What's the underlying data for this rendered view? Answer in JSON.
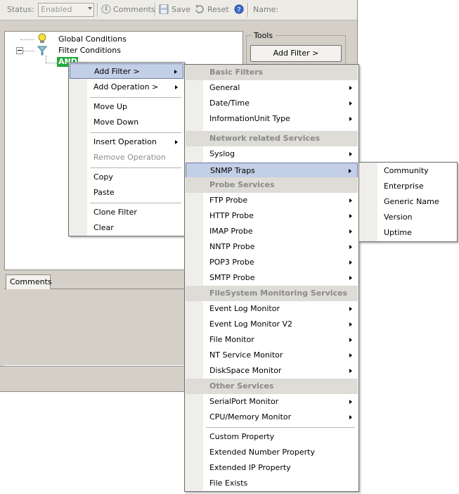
{
  "toolbar": {
    "status_label": "Status:",
    "status_value": "Enabled",
    "comments_label": "Comments",
    "save_label": "Save",
    "reset_label": "Reset",
    "name_label": "Name:"
  },
  "tree": {
    "global": "Global Conditions",
    "filter": "Filter Conditions",
    "and": "AND"
  },
  "tools": {
    "title": "Tools",
    "add_filter": "Add Filter >"
  },
  "comments_tab": "Comments",
  "context_menu": {
    "add_filter": "Add Filter >",
    "add_operation": "Add Operation >",
    "move_up": "Move Up",
    "move_down": "Move Down",
    "insert_operation": "Insert Operation",
    "remove_operation": "Remove Operation",
    "copy": "Copy",
    "paste": "Paste",
    "clone_filter": "Clone Filter",
    "clear": "Clear"
  },
  "filter_menu": {
    "basic_header": "Basic Filters",
    "general": "General",
    "datetime": "Date/Time",
    "infounit": "InformationUnit Type",
    "network_header": "Network related Services",
    "syslog": "Syslog",
    "snmp": "SNMP Traps",
    "probe_header": "Probe Services",
    "ftp": "FTP Probe",
    "http": "HTTP Probe",
    "imap": "IMAP Probe",
    "nntp": "NNTP Probe",
    "pop3": "POP3 Probe",
    "smtp": "SMTP Probe",
    "fs_header": "FileSystem Monitoring Services",
    "eventlog": "Event Log Monitor",
    "eventlog2": "Event Log Monitor V2",
    "filemon": "File Monitor",
    "ntservice": "NT Service Monitor",
    "diskspace": "DiskSpace Monitor",
    "other_header": "Other Services",
    "serialport": "SerialPort Monitor",
    "cpumem": "CPU/Memory Monitor",
    "custom_prop": "Custom Property",
    "ext_number": "Extended Number Property",
    "ext_ip": "Extended IP Property",
    "file_exists": "File Exists"
  },
  "snmp_menu": {
    "community": "Community",
    "enterprise": "Enterprise",
    "generic_name": "Generic Name",
    "version": "Version",
    "uptime": "Uptime"
  },
  "colors": {
    "highlight": "#c3cfe6",
    "and_badge": "#1fa83a",
    "menu_header": "#dedcd6"
  }
}
